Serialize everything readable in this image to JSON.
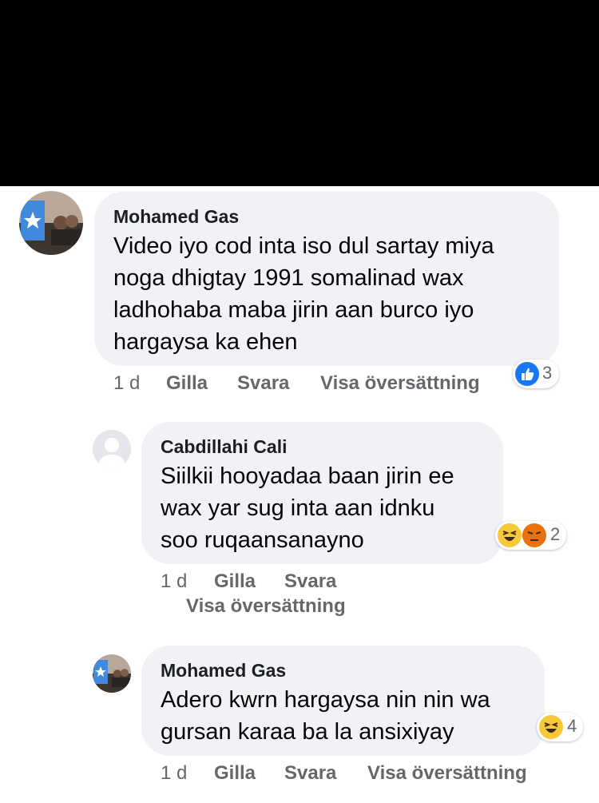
{
  "comments": [
    {
      "author": "Mohamed Gas",
      "lines": [
        "Video iyo cod inta iso dul sartay miya",
        "noga dhigtay 1991 somalinad wax",
        "ladhohaba maba jirin aan burco iyo",
        "hargaysa ka ehen"
      ],
      "time": "1 d",
      "like": "Gilla",
      "reply": "Svara",
      "translate": "Visa översättning",
      "reactions": {
        "icons": [
          "like-icon"
        ],
        "count": "3"
      }
    },
    {
      "author": "Cabdillahi Cali",
      "lines": [
        "Siilkii hooyadaa baan jirin ee",
        "wax yar sug inta aan idnku",
        "soo ruqaansanayno"
      ],
      "time": "1 d",
      "like": "Gilla",
      "reply": "Svara",
      "translate": "Visa översättning",
      "reactions": {
        "icons": [
          "haha-emoji-icon",
          "angry-emoji-icon"
        ],
        "count": "2"
      }
    },
    {
      "author": "Mohamed Gas",
      "lines": [
        "Adero kwrn hargaysa nin nin wa",
        "gursan karaa ba la ansixiyay"
      ],
      "time": "1 d",
      "like": "Gilla",
      "reply": "Svara",
      "translate": "Visa översättning",
      "reactions": {
        "icons": [
          "haha-emoji-icon"
        ],
        "count": "4"
      }
    }
  ],
  "colors": {
    "bubble": "#f0f2f5",
    "meta": "#65676b",
    "like_blue": "#1877f2",
    "emoji_yellow": "#f7c83a",
    "angry_red": "#e9710f",
    "flag_blue": "#4189dd"
  }
}
